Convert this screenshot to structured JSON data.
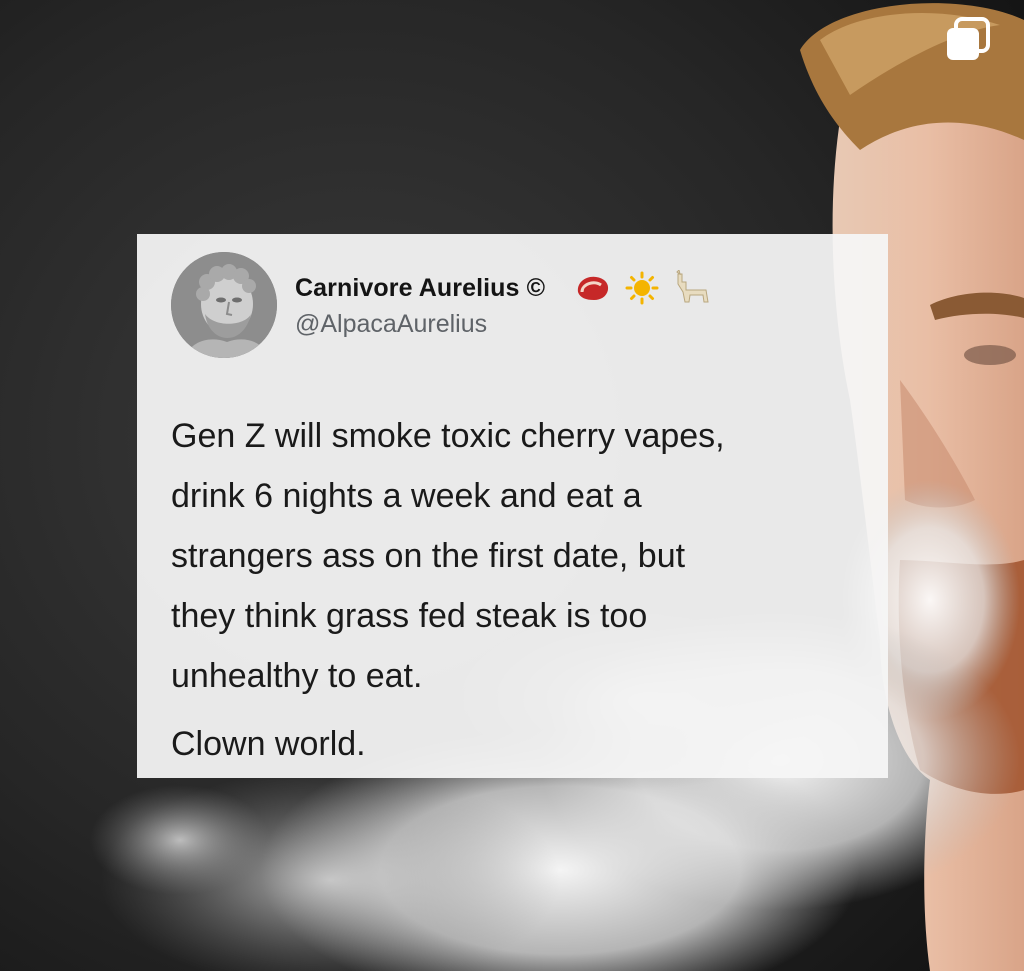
{
  "post": {
    "author": {
      "display_name": "Carnivore Aurelius ©",
      "handle": "@AlpacaAurelius",
      "name_emoji_icons": [
        "steak-icon",
        "sun-icon",
        "llama-icon"
      ]
    },
    "body_lines": [
      "Gen Z will smoke toxic cherry vapes,",
      "drink 6 nights a week and eat a",
      "strangers ass on the first date, but",
      "they think grass fed steak is too",
      "unhealthy to eat."
    ],
    "signoff": "Clown world."
  },
  "colors": {
    "card_background": "#f5f5f5",
    "name_text": "#141414",
    "handle_text": "#5f6368",
    "body_text": "#1a1a1a"
  }
}
